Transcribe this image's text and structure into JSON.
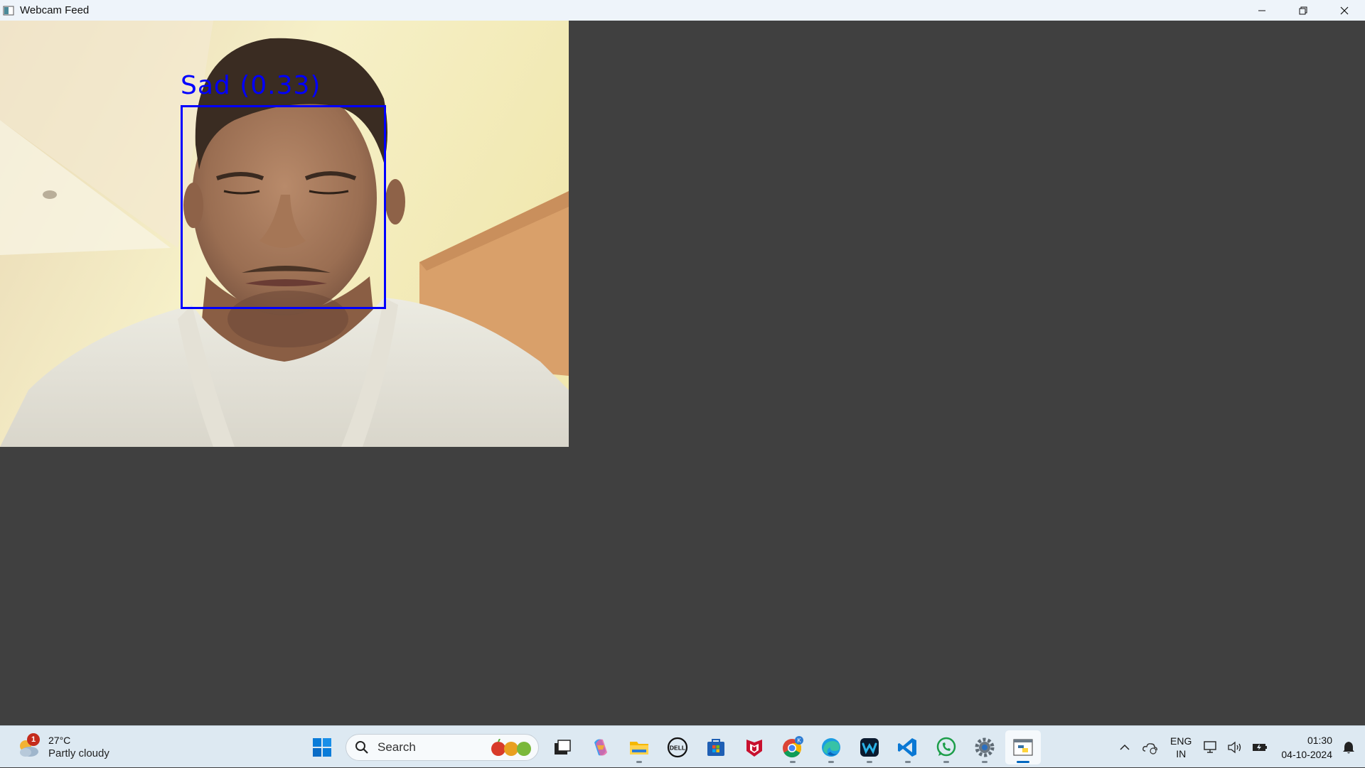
{
  "window": {
    "title": "Webcam Feed",
    "controls": {
      "minimize_icon": "minimize-icon",
      "restore_icon": "restore-icon",
      "close_icon": "close-icon"
    }
  },
  "feed": {
    "detection": {
      "label": "Sad (0.33)",
      "box_color": "#0000ff"
    }
  },
  "taskbar": {
    "weather": {
      "badge": "1",
      "temperature": "27°C",
      "condition": "Partly cloudy"
    },
    "search": {
      "placeholder": "Search"
    },
    "apps": [
      "windows-start-icon",
      "task-view-icon",
      "copilot-icon",
      "file-explorer-icon",
      "dell-icon",
      "microsoft-store-icon",
      "mcafee-icon",
      "chrome-icon",
      "edge-icon",
      "webex-icon",
      "vscode-icon",
      "whatsapp-icon",
      "settings-icon",
      "python-app-icon"
    ],
    "chrome_badge": "K",
    "tray": {
      "language_line1": "ENG",
      "language_line2": "IN",
      "time": "01:30",
      "date": "04-10-2024"
    }
  }
}
